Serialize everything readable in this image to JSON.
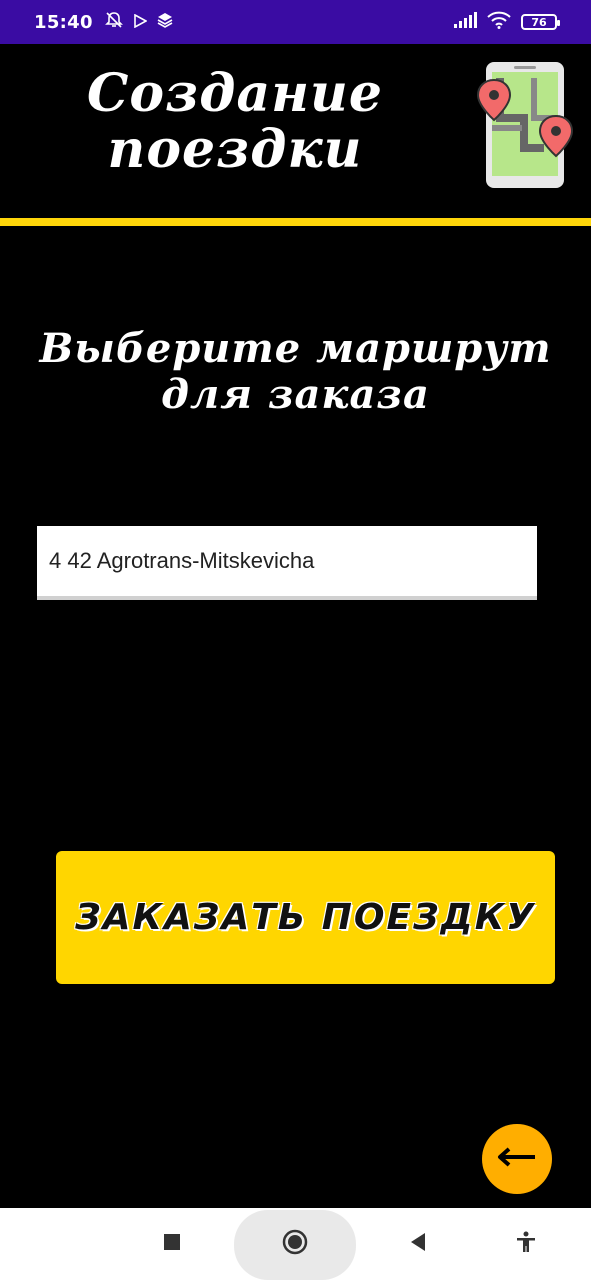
{
  "status_bar": {
    "time": "15:40",
    "left_icons": [
      "notifications-off-icon",
      "play-store-icon",
      "layers-icon"
    ],
    "right_icons": [
      "signal-icon",
      "wifi-icon"
    ],
    "battery": "76"
  },
  "header": {
    "title": "Создание поездки",
    "icon": "map-route-phone-icon"
  },
  "prompt": {
    "text": "Выберите маршрут для заказа"
  },
  "route_select": {
    "value": "4 42 Agrotrans-Mitskevicha"
  },
  "order_button": {
    "label": "ЗАКАЗАТЬ ПОЕЗДКУ"
  },
  "back_button": {
    "icon": "arrow-left-icon"
  },
  "colors": {
    "status_bar": "#3a0ca3",
    "accent_yellow": "#ffd600",
    "fab_orange": "#ffae00",
    "background": "#000000"
  },
  "nav_bar": {
    "items": [
      "recents-square-icon",
      "home-circle-icon",
      "back-triangle-icon",
      "accessibility-icon"
    ]
  }
}
